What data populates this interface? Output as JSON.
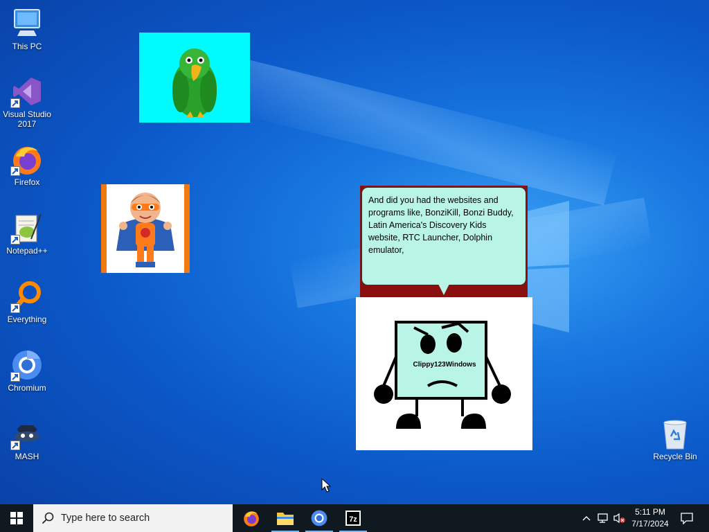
{
  "desktop": {
    "icons": [
      {
        "label": "This PC",
        "icon": "this-pc-icon"
      },
      {
        "label": "Visual Studio 2017",
        "icon": "visual-studio-icon"
      },
      {
        "label": "Firefox",
        "icon": "firefox-icon"
      },
      {
        "label": "Notepad++",
        "icon": "notepadpp-icon"
      },
      {
        "label": "Everything",
        "icon": "everything-search-icon"
      },
      {
        "label": "Chromium",
        "icon": "chromium-icon"
      },
      {
        "label": "MASH",
        "icon": "mash-icon"
      },
      {
        "label": "Recycle Bin",
        "icon": "recycle-bin-icon"
      }
    ]
  },
  "speech": {
    "text": "And did you had the websites and programs like, BonziKill, Bonzi Buddy, Latin America's Discovery Kids website, RTC Launcher, Dolphin emulator,"
  },
  "character": {
    "name": "Clippy123Windows"
  },
  "taskbar": {
    "search_placeholder": "Type here to search",
    "pinned": [
      {
        "name": "firefox",
        "icon": "firefox-icon"
      },
      {
        "name": "file-explorer",
        "icon": "folder-icon"
      },
      {
        "name": "chromium",
        "icon": "chromium-icon"
      },
      {
        "name": "7-zip",
        "icon": "7zip-icon"
      }
    ],
    "clock_time": "5:11 PM",
    "clock_date": "7/17/2024"
  },
  "colors": {
    "desktop_blue": "#0b58c9",
    "taskbar": "#101820",
    "bubble": "#b9f5e6",
    "parrot_bg": "#00fbff"
  }
}
